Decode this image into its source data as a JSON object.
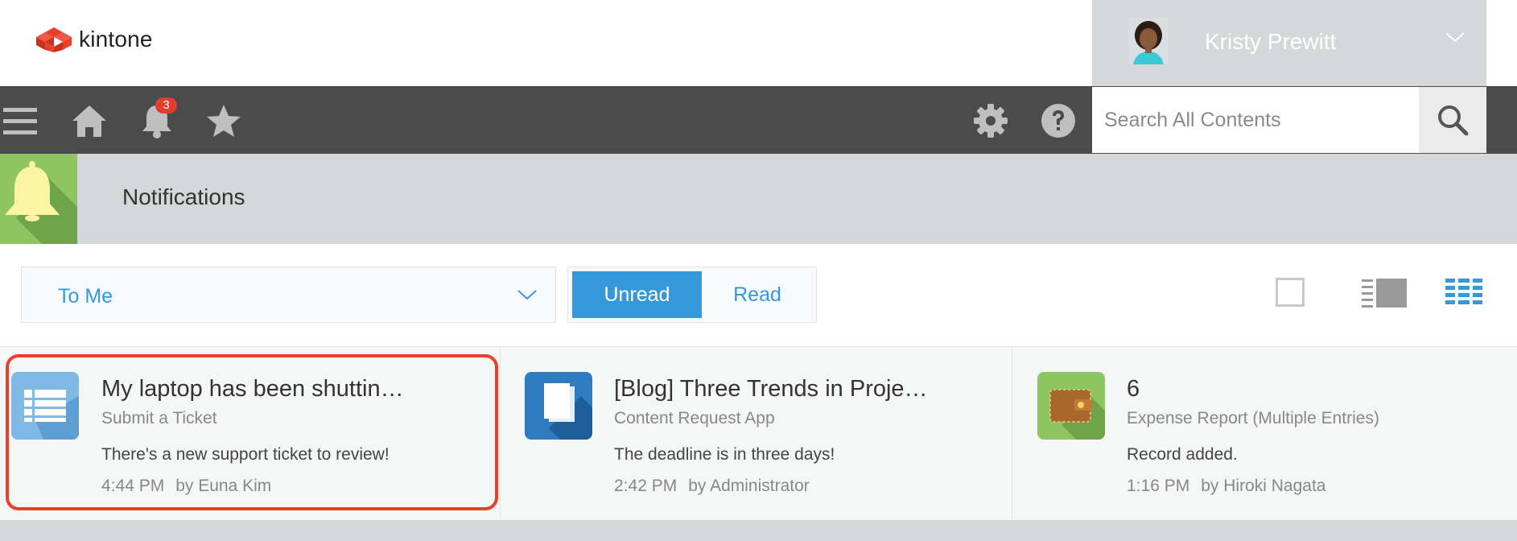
{
  "app": {
    "logo_text": "kintone",
    "brand_color": "#e8402a",
    "accent": "#3498db"
  },
  "user": {
    "name": "Kristy Prewitt"
  },
  "nav": {
    "notification_count": "3",
    "icons": [
      "menu-icon",
      "home-icon",
      "bell-icon",
      "star-icon",
      "gear-icon",
      "help-icon"
    ]
  },
  "search": {
    "placeholder": "Search All Contents"
  },
  "page": {
    "title": "Notifications"
  },
  "filter": {
    "selected": "To Me"
  },
  "tabs": {
    "unread": "Unread",
    "read": "Read",
    "active": "Unread"
  },
  "view_icons": [
    "checkbox-icon",
    "preview-view-icon",
    "list-view-icon"
  ],
  "notifications": [
    {
      "title": "My laptop has been shuttin…",
      "app": "Submit a Ticket",
      "message": "There's a new support ticket to review!",
      "time": "4:44 PM",
      "by": "by Euna Kim",
      "icon": "list-app-icon",
      "highlighted": true
    },
    {
      "title": "[Blog] Three Trends in Proje…",
      "app": "Content Request App",
      "message": "The deadline is in three days!",
      "time": "2:42 PM",
      "by": "by Administrator",
      "icon": "document-app-icon",
      "highlighted": false
    },
    {
      "title": "6",
      "app": "Expense Report (Multiple Entries)",
      "message": "Record added.",
      "time": "1:16 PM",
      "by": "by Hiroki Nagata",
      "icon": "wallet-app-icon",
      "highlighted": false
    }
  ]
}
